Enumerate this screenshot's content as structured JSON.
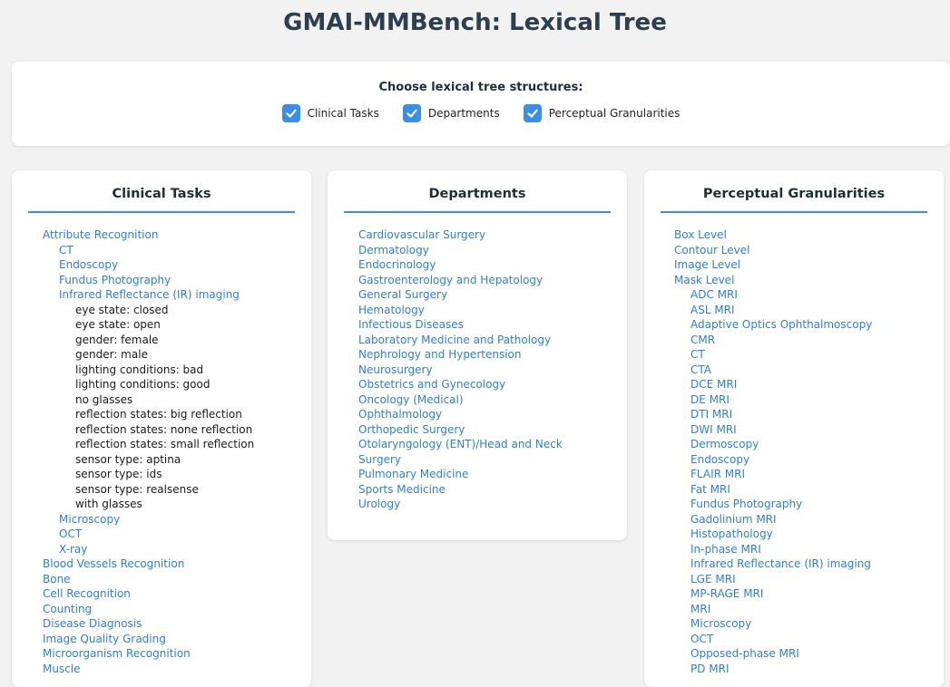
{
  "title": "GMAI-MMBench: Lexical Tree",
  "selector": {
    "heading": "Choose lexical tree structures:",
    "options": [
      {
        "label": "Clinical Tasks",
        "checked": true
      },
      {
        "label": "Departments",
        "checked": true
      },
      {
        "label": "Perceptual Granularities",
        "checked": true
      }
    ]
  },
  "colors": {
    "accent": "#3a8ee6",
    "link": "#2f7fd0",
    "title": "#2d3e50"
  },
  "columns": [
    {
      "title": "Clinical Tasks",
      "items": [
        {
          "text": "Attribute Recognition",
          "level": 1,
          "link": true
        },
        {
          "text": "CT",
          "level": 2,
          "link": true
        },
        {
          "text": "Endoscopy",
          "level": 2,
          "link": true
        },
        {
          "text": "Fundus Photography",
          "level": 2,
          "link": true
        },
        {
          "text": "Infrared Reflectance (IR) imaging",
          "level": 2,
          "link": true
        },
        {
          "text": "eye state: closed",
          "level": 3,
          "link": false
        },
        {
          "text": "eye state: open",
          "level": 3,
          "link": false
        },
        {
          "text": "gender: female",
          "level": 3,
          "link": false
        },
        {
          "text": "gender: male",
          "level": 3,
          "link": false
        },
        {
          "text": "lighting conditions: bad",
          "level": 3,
          "link": false
        },
        {
          "text": "lighting conditions: good",
          "level": 3,
          "link": false
        },
        {
          "text": "no glasses",
          "level": 3,
          "link": false
        },
        {
          "text": "reflection states: big reflection",
          "level": 3,
          "link": false
        },
        {
          "text": "reflection states: none reflection",
          "level": 3,
          "link": false
        },
        {
          "text": "reflection states: small reflection",
          "level": 3,
          "link": false
        },
        {
          "text": "sensor type: aptina",
          "level": 3,
          "link": false
        },
        {
          "text": "sensor type: ids",
          "level": 3,
          "link": false
        },
        {
          "text": "sensor type: realsense",
          "level": 3,
          "link": false
        },
        {
          "text": "with glasses",
          "level": 3,
          "link": false
        },
        {
          "text": "Microscopy",
          "level": 2,
          "link": true
        },
        {
          "text": "OCT",
          "level": 2,
          "link": true
        },
        {
          "text": "X-ray",
          "level": 2,
          "link": true
        },
        {
          "text": "Blood Vessels Recognition",
          "level": 1,
          "link": true
        },
        {
          "text": "Bone",
          "level": 1,
          "link": true
        },
        {
          "text": "Cell Recognition",
          "level": 1,
          "link": true
        },
        {
          "text": "Counting",
          "level": 1,
          "link": true
        },
        {
          "text": "Disease Diagnosis",
          "level": 1,
          "link": true
        },
        {
          "text": "Image Quality Grading",
          "level": 1,
          "link": true
        },
        {
          "text": "Microorganism Recognition",
          "level": 1,
          "link": true
        },
        {
          "text": "Muscle",
          "level": 1,
          "link": true
        }
      ]
    },
    {
      "title": "Departments",
      "items": [
        {
          "text": "Cardiovascular Surgery",
          "level": 1,
          "link": true
        },
        {
          "text": "Dermatology",
          "level": 1,
          "link": true
        },
        {
          "text": "Endocrinology",
          "level": 1,
          "link": true
        },
        {
          "text": "Gastroenterology and Hepatology",
          "level": 1,
          "link": true
        },
        {
          "text": "General Surgery",
          "level": 1,
          "link": true
        },
        {
          "text": "Hematology",
          "level": 1,
          "link": true
        },
        {
          "text": "Infectious Diseases",
          "level": 1,
          "link": true
        },
        {
          "text": "Laboratory Medicine and Pathology",
          "level": 1,
          "link": true
        },
        {
          "text": "Nephrology and Hypertension",
          "level": 1,
          "link": true
        },
        {
          "text": "Neurosurgery",
          "level": 1,
          "link": true
        },
        {
          "text": "Obstetrics and Gynecology",
          "level": 1,
          "link": true
        },
        {
          "text": "Oncology (Medical)",
          "level": 1,
          "link": true
        },
        {
          "text": "Ophthalmology",
          "level": 1,
          "link": true
        },
        {
          "text": "Orthopedic Surgery",
          "level": 1,
          "link": true
        },
        {
          "text": "Otolaryngology (ENT)/Head and Neck",
          "level": 1,
          "link": true
        },
        {
          "text": "Surgery",
          "level": 1,
          "link": true
        },
        {
          "text": "Pulmonary Medicine",
          "level": 1,
          "link": true
        },
        {
          "text": "Sports Medicine",
          "level": 1,
          "link": true
        },
        {
          "text": "Urology",
          "level": 1,
          "link": true
        }
      ]
    },
    {
      "title": "Perceptual Granularities",
      "items": [
        {
          "text": "Box Level",
          "level": 1,
          "link": true
        },
        {
          "text": "Contour Level",
          "level": 1,
          "link": true
        },
        {
          "text": "Image Level",
          "level": 1,
          "link": true
        },
        {
          "text": "Mask Level",
          "level": 1,
          "link": true
        },
        {
          "text": "ADC MRI",
          "level": 2,
          "link": true
        },
        {
          "text": "ASL MRI",
          "level": 2,
          "link": true
        },
        {
          "text": "Adaptive Optics Ophthalmoscopy",
          "level": 2,
          "link": true
        },
        {
          "text": "CMR",
          "level": 2,
          "link": true
        },
        {
          "text": "CT",
          "level": 2,
          "link": true
        },
        {
          "text": "CTA",
          "level": 2,
          "link": true
        },
        {
          "text": "DCE MRI",
          "level": 2,
          "link": true
        },
        {
          "text": "DE MRI",
          "level": 2,
          "link": true
        },
        {
          "text": "DTI MRI",
          "level": 2,
          "link": true
        },
        {
          "text": "DWI MRI",
          "level": 2,
          "link": true
        },
        {
          "text": "Dermoscopy",
          "level": 2,
          "link": true
        },
        {
          "text": "Endoscopy",
          "level": 2,
          "link": true
        },
        {
          "text": "FLAIR MRI",
          "level": 2,
          "link": true
        },
        {
          "text": "Fat MRI",
          "level": 2,
          "link": true
        },
        {
          "text": "Fundus Photography",
          "level": 2,
          "link": true
        },
        {
          "text": "Gadolinium MRI",
          "level": 2,
          "link": true
        },
        {
          "text": "Histopathology",
          "level": 2,
          "link": true
        },
        {
          "text": "In-phase MRI",
          "level": 2,
          "link": true
        },
        {
          "text": "Infrared Reflectance (IR) imaging",
          "level": 2,
          "link": true
        },
        {
          "text": "LGE MRI",
          "level": 2,
          "link": true
        },
        {
          "text": "MP-RAGE MRI",
          "level": 2,
          "link": true
        },
        {
          "text": "MRI",
          "level": 2,
          "link": true
        },
        {
          "text": "Microscopy",
          "level": 2,
          "link": true
        },
        {
          "text": "OCT",
          "level": 2,
          "link": true
        },
        {
          "text": "Opposed-phase MRI",
          "level": 2,
          "link": true
        },
        {
          "text": "PD MRI",
          "level": 2,
          "link": true
        }
      ]
    }
  ]
}
